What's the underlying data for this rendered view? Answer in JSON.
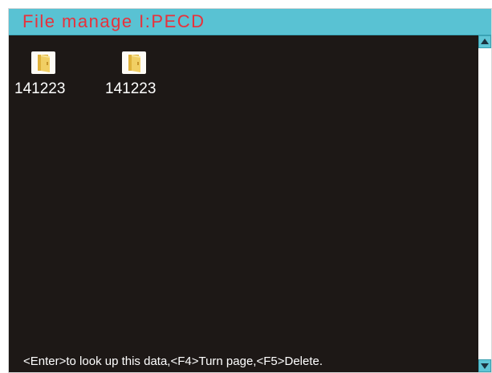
{
  "window": {
    "title": "File manage I:PECD"
  },
  "files": [
    {
      "name": "141223",
      "icon": "folder-icon"
    },
    {
      "name": "141223",
      "icon": "folder-icon"
    }
  ],
  "footer": {
    "hint": "<Enter>to look up this data,<F4>Turn page,<F5>Delete."
  },
  "scrollbar": {
    "up_icon": "arrow-up-icon",
    "down_icon": "arrow-down-icon"
  },
  "colors": {
    "title_bar": "#59c2d3",
    "title_text": "#e8313b",
    "background": "#1d1816",
    "text": "#ffffff"
  }
}
